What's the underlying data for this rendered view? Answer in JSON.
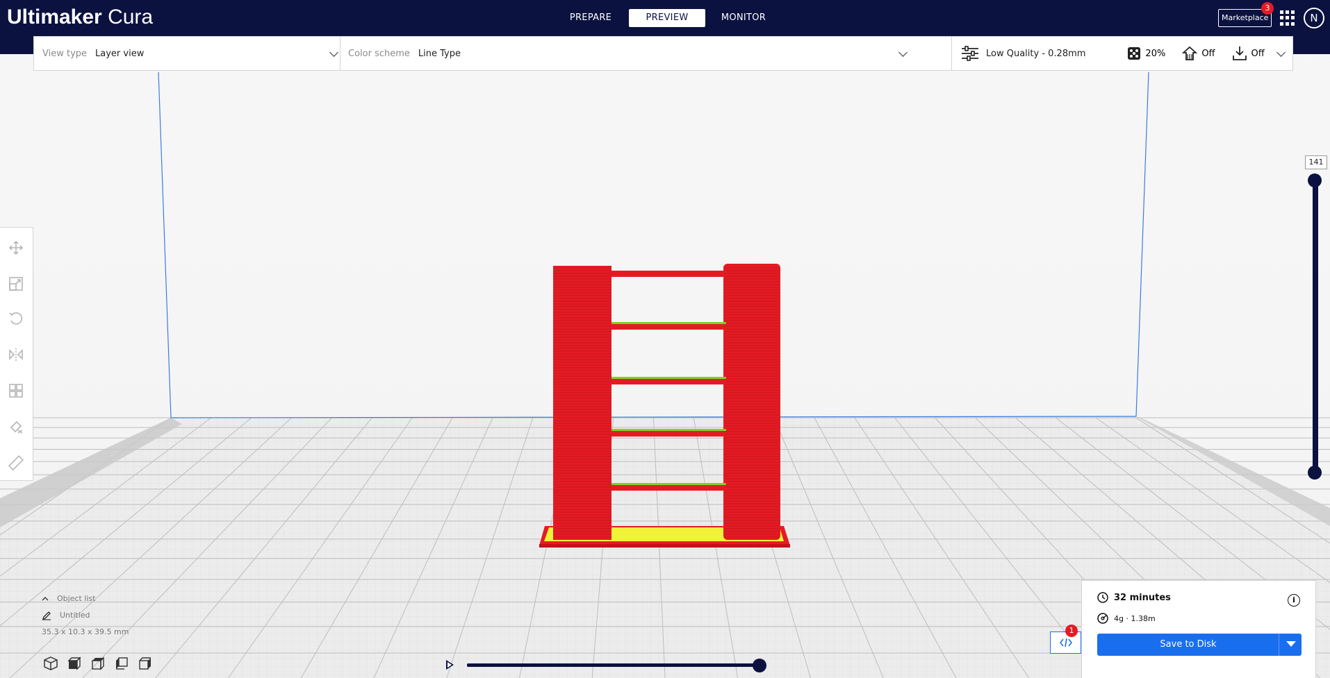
{
  "app": {
    "brand_bold": "Ultimaker",
    "brand_light": " Cura"
  },
  "stages": [
    {
      "label": "PREPARE",
      "active": false
    },
    {
      "label": "PREVIEW",
      "active": true
    },
    {
      "label": "MONITOR",
      "active": false
    }
  ],
  "header": {
    "marketplace_label": "Marketplace",
    "marketplace_badge": "3",
    "avatar_initial": "N"
  },
  "viewbar": {
    "view_type_label": "View type",
    "view_type_value": "Layer view",
    "color_scheme_label": "Color scheme",
    "color_scheme_value": "Line Type",
    "quality": "Low Quality - 0.28mm",
    "infill": "20%",
    "support": "Off",
    "adhesion": "Off"
  },
  "layer": {
    "current": "141"
  },
  "object_list": {
    "toggle_label": "Object list",
    "name": "Untitled",
    "dimensions": "35.3 x 10.3 x 39.5 mm"
  },
  "output": {
    "print_time": "32 minutes",
    "material": "4g · 1.38m",
    "save_label": "Save to Disk",
    "code_badge": "1"
  },
  "colors": {
    "header_bg": "#0b1240",
    "accent": "#196ef0",
    "wall": "#e51b24",
    "infill": "#f2f23a",
    "badge": "#e51b24"
  },
  "icons": [
    "move-icon",
    "scale-icon",
    "rotate-icon",
    "mirror-icon",
    "per-model-settings-icon",
    "support-blocker-icon",
    "measure-icon"
  ]
}
